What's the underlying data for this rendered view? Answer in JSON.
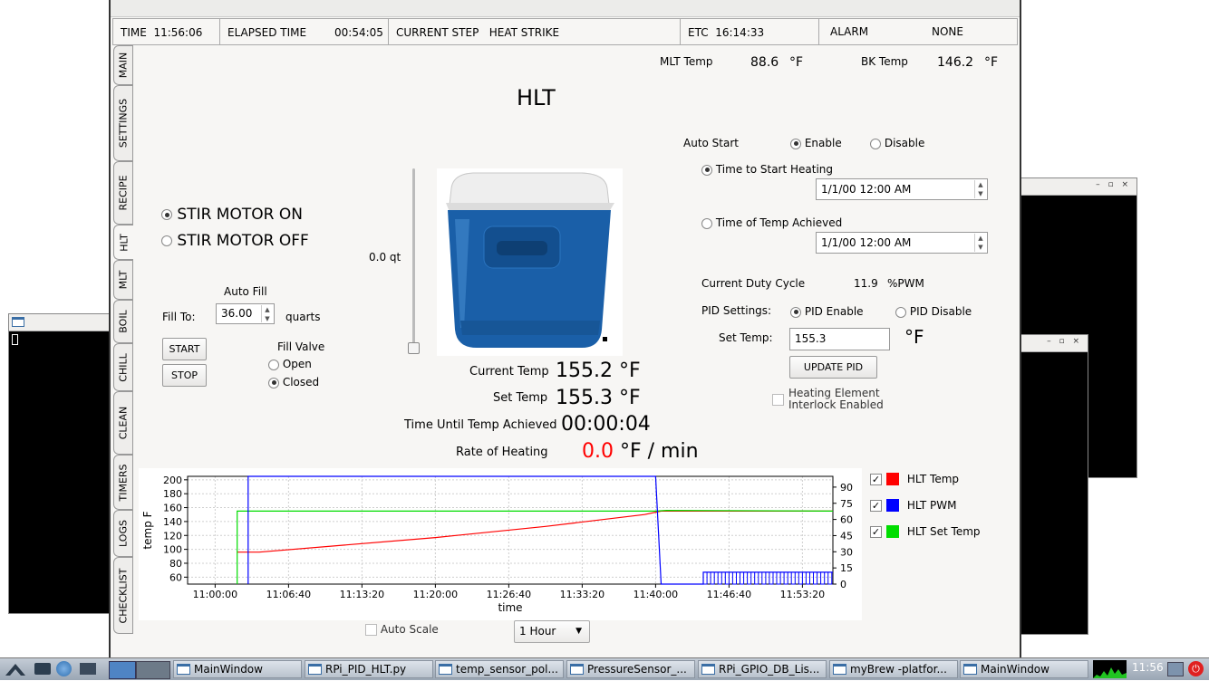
{
  "status_bar": {
    "time_label": "TIME",
    "time_value": "11:56:06",
    "elapsed_label": "ELAPSED TIME",
    "elapsed_value": "00:54:05",
    "step_label": "CURRENT STEP",
    "step_value": "HEAT STRIKE",
    "etc_label": "ETC",
    "etc_value": "16:14:33",
    "alarm_label": "ALARM",
    "alarm_value": "NONE"
  },
  "tabs": [
    "MAIN",
    "SETTINGS",
    "RECIPE",
    "HLT",
    "MLT",
    "BOIL",
    "CHILL",
    "CLEAN",
    "TIMERS",
    "LOGS",
    "CHECKLIST"
  ],
  "active_tab": "HLT",
  "temps": {
    "mlt_label": "MLT Temp",
    "mlt_value": "88.6",
    "mlt_unit": "°F",
    "bk_label": "BK Temp",
    "bk_value": "146.2",
    "bk_unit": "°F"
  },
  "page_title": "HLT",
  "stir": {
    "on_label": "STIR MOTOR ON",
    "off_label": "STIR MOTOR OFF",
    "selected": "on"
  },
  "volume": {
    "value": "0.0 qt"
  },
  "auto_fill": {
    "title": "Auto Fill",
    "fill_to_label": "Fill To:",
    "fill_to_value": "36.00",
    "unit": "quarts",
    "start_label": "START",
    "stop_label": "STOP",
    "valve_label": "Fill Valve",
    "open_label": "Open",
    "closed_label": "Closed",
    "valve_state": "closed"
  },
  "readings": {
    "current_temp_label": "Current Temp",
    "current_temp_value": "155.2 °F",
    "set_temp_label": "Set Temp",
    "set_temp_value": "155.3 °F",
    "time_until_label": "Time Until Temp Achieved",
    "time_until_value": "00:00:04",
    "rate_label": "Rate of Heating",
    "rate_value": "0.0",
    "rate_unit": "°F / min"
  },
  "auto_start": {
    "label": "Auto Start",
    "enable_label": "Enable",
    "disable_label": "Disable",
    "state": "enable",
    "start_heating_label": "Time to Start Heating",
    "start_heating_value": "1/1/00 12:00 AM",
    "temp_achieved_label": "Time of Temp Achieved",
    "temp_achieved_value": "1/1/00 12:00 AM",
    "mode": "start_heating"
  },
  "pid": {
    "duty_label": "Current Duty Cycle",
    "duty_value": "11.9",
    "duty_unit": "%PWM",
    "settings_label": "PID Settings:",
    "enable_label": "PID Enable",
    "disable_label": "PID Disable",
    "state": "enable",
    "set_temp_label": "Set Temp:",
    "set_temp_value": "155.3",
    "set_temp_unit": "°F",
    "update_label": "UPDATE PID",
    "interlock_label_1": "Heating Element",
    "interlock_label_2": "Interlock Enabled",
    "interlock_checked": false
  },
  "legend": {
    "hlt_temp": "HLT Temp",
    "hlt_pwm": "HLT PWM",
    "hlt_set": "HLT Set Temp"
  },
  "chart_controls": {
    "auto_scale_label": "Auto Scale",
    "range_value": "1 Hour"
  },
  "colors": {
    "temp": "#ff0000",
    "pwm": "#0000ff",
    "set": "#00dd00",
    "rate": "#ff0000"
  },
  "chart_data": {
    "type": "line",
    "xlabel": "time",
    "ylabel": "temp F",
    "x_ticks": [
      "11:00:00",
      "11:06:40",
      "11:13:20",
      "11:20:00",
      "11:26:40",
      "11:33:20",
      "11:40:00",
      "11:46:40",
      "11:53:20"
    ],
    "y_ticks_left": [
      "60",
      "80",
      "100",
      "120",
      "140",
      "160",
      "180",
      "200"
    ],
    "y_ticks_right": [
      "0",
      "15",
      "30",
      "45",
      "60",
      "75",
      "90"
    ],
    "ylim_left": [
      50,
      205
    ],
    "ylim_right": [
      0,
      100
    ],
    "xlim": [
      "10:57:30",
      "11:56:06"
    ],
    "series": [
      {
        "name": "HLT Temp",
        "axis": "left",
        "color": "#ff0000",
        "points": [
          [
            "11:02:00",
            96
          ],
          [
            "11:04:00",
            96
          ],
          [
            "11:20:00",
            117
          ],
          [
            "11:30:00",
            133
          ],
          [
            "11:39:00",
            150
          ],
          [
            "11:40:30",
            155
          ],
          [
            "11:56:06",
            155
          ]
        ]
      },
      {
        "name": "HLT Set Temp",
        "axis": "left",
        "color": "#00dd00",
        "points": [
          [
            "11:02:00",
            50
          ],
          [
            "11:02:00",
            155
          ],
          [
            "11:40:00",
            155
          ],
          [
            "11:41:00",
            156
          ],
          [
            "11:56:06",
            155
          ]
        ]
      },
      {
        "name": "HLT PWM",
        "axis": "right",
        "color": "#0000ff",
        "points": [
          [
            "11:03:00",
            0
          ],
          [
            "11:03:00",
            100
          ],
          [
            "11:40:00",
            100
          ],
          [
            "11:40:30",
            0
          ],
          [
            "11:44:20",
            0
          ],
          [
            "11:44:20",
            11
          ],
          [
            "11:56:06",
            11
          ]
        ]
      }
    ]
  },
  "taskbar": {
    "items": [
      "MainWindow",
      "RPi_PID_HLT.py",
      "temp_sensor_pol...",
      "PressureSensor_...",
      "RPi_GPIO_DB_Lis...",
      "myBrew -platfor...",
      "MainWindow"
    ],
    "clock": "11:56"
  }
}
